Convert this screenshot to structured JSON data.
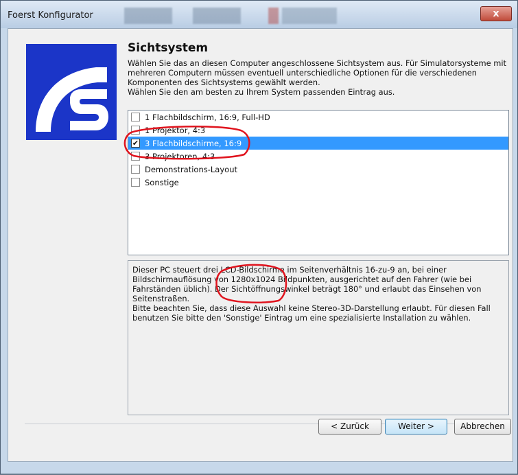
{
  "window": {
    "title": "Foerst Konfigurator",
    "close_label": "x"
  },
  "page": {
    "title": "Sichtsystem",
    "description": [
      "Wählen Sie das an diesen Computer angeschlossene Sichtsystem aus. Für Simulatorsysteme mit mehreren Computern müssen eventuell unterschiedliche Optionen für die verschiedenen Komponenten des Sichtsystems gewählt werden.",
      "Wählen Sie den am besten zu Ihrem System passenden Eintrag aus."
    ]
  },
  "options": [
    {
      "label": "1 Flachbildschirm, 16:9, Full-HD",
      "checked": false,
      "selected": false
    },
    {
      "label": "1 Projektor, 4:3",
      "checked": false,
      "selected": false
    },
    {
      "label": "3 Flachbildschirme, 16:9",
      "checked": true,
      "selected": true
    },
    {
      "label": "3 Projektoren, 4:3",
      "checked": false,
      "selected": false
    },
    {
      "label": "Demonstrations-Layout",
      "checked": false,
      "selected": false
    },
    {
      "label": "Sonstige",
      "checked": false,
      "selected": false
    }
  ],
  "details": [
    "Dieser PC steuert drei LCD-Bildschirme im Seitenverhältnis 16-zu-9 an, bei einer Bildschirmauflösung von 1280x1024 Bildpunkten, ausgerichtet auf den Fahrer (wie bei Fahrständen üblich). Der Sichtöffnungswinkel beträgt 180° und erlaubt das Einsehen von Seitenstraßen.",
    "Bitte beachten Sie, dass diese Auswahl keine Stereo-3D-Darstellung erlaubt. Für diesen Fall benutzen Sie bitte den 'Sonstige' Eintrag um eine spezialisierte Installation zu wählen."
  ],
  "buttons": {
    "back": "< Zurück",
    "next": "Weiter >",
    "cancel": "Abbrechen"
  },
  "colors": {
    "accent": "#3399ff",
    "logo_blue": "#1b35c8",
    "annotation_red": "#e0141e"
  },
  "icons": {
    "logo": "foerst-logo",
    "check": "check-icon",
    "close": "close-icon"
  }
}
